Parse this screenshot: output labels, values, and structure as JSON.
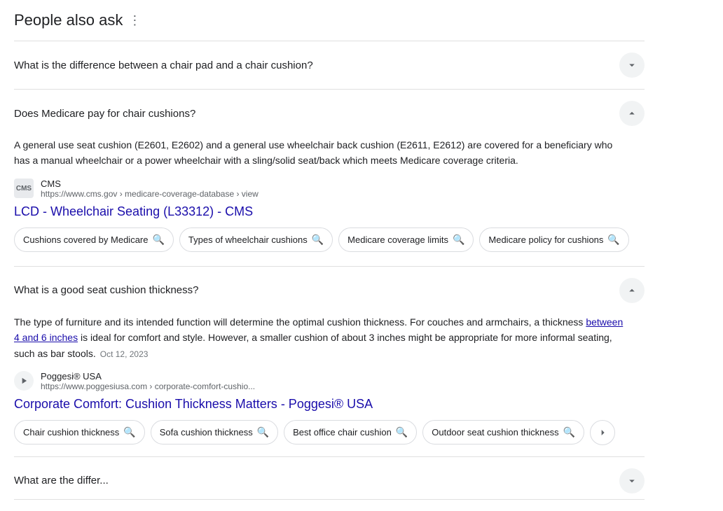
{
  "section": {
    "title": "People also ask",
    "more_label": "⋮"
  },
  "faqs": [
    {
      "id": "faq-1",
      "question": "What is the difference between a chair pad and a chair cushion?",
      "expanded": false,
      "answer": null,
      "source": null,
      "link": null,
      "chips": []
    },
    {
      "id": "faq-2",
      "question": "Does Medicare pay for chair cushions?",
      "expanded": true,
      "answer": "A general use seat cushion (E2601, E2602) and a general use wheelchair back cushion (E2611, E2612) are covered for a beneficiary who has a manual wheelchair or a power wheelchair with a sling/solid seat/back which meets Medicare coverage criteria.",
      "highlight_text": null,
      "source_type": "logo",
      "source_name": "CMS",
      "source_url": "https://www.cms.gov › medicare-coverage-database › view",
      "link_text": "LCD - Wheelchair Seating (L33312) - CMS",
      "chips": [
        "Cushions covered by Medicare",
        "Types of wheelchair cushions",
        "Medicare coverage limits",
        "Medicare policy for cushions"
      ]
    },
    {
      "id": "faq-3",
      "question": "What is a good seat cushion thickness?",
      "expanded": true,
      "answer_before": "The type of furniture and its intended function will determine the optimal cushion thickness. For couches and armchairs, a thickness ",
      "answer_highlight": "between 4 and 6 inches",
      "answer_after": " is ideal for comfort and style. However, a smaller cushion of about 3 inches might be appropriate for more informal seating, such as bar stools.",
      "answer_date": "Oct 12, 2023",
      "source_type": "play",
      "source_name": "Poggesi® USA",
      "source_url": "https://www.poggesiusa.com › corporate-comfort-cushio...",
      "link_text": "Corporate Comfort: Cushion Thickness Matters - Poggesi® USA",
      "chips": [
        "Chair cushion thickness",
        "Sofa cushion thickness",
        "Best office chair cushion",
        "Outdoor seat cushion thickness"
      ],
      "has_nav": true
    },
    {
      "id": "faq-4",
      "question": "What are the differ...",
      "expanded": false,
      "partial": true
    }
  ],
  "chevron_up": "up",
  "chevron_down": "down"
}
